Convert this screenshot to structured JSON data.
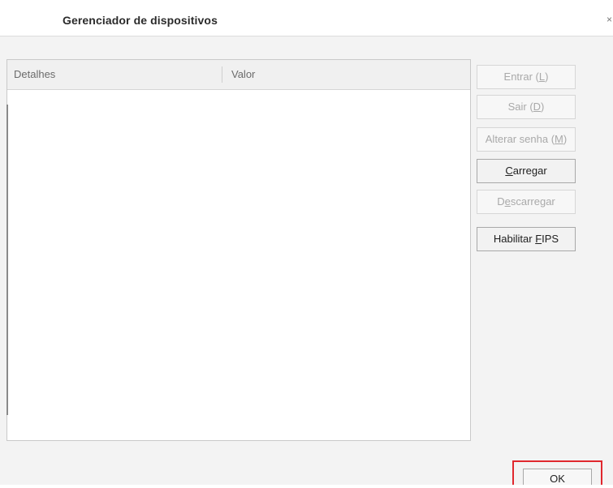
{
  "window": {
    "title": "Gerenciador de dispositivos",
    "close_glyph": "×"
  },
  "list": {
    "columns": [
      "Detalhes",
      "Valor"
    ],
    "rows": []
  },
  "buttons": [
    {
      "pre": "Entrar (",
      "key": "L",
      "post": ")",
      "enabled": false
    },
    {
      "pre": "Sair (",
      "key": "D",
      "post": ")",
      "enabled": false
    },
    {
      "pre": "Alterar senha (",
      "key": "M",
      "post": ")",
      "enabled": false
    },
    {
      "pre": "",
      "key": "C",
      "post": "arregar",
      "enabled": true
    },
    {
      "pre": "D",
      "key": "e",
      "post": "scarregar",
      "enabled": false
    },
    {
      "pre": "Habilitar ",
      "key": "F",
      "post": "IPS",
      "enabled": true
    }
  ],
  "footer": {
    "ok_label": "OK"
  },
  "colors": {
    "highlight": "#e0282e",
    "disabled_text": "#a9a9a9",
    "enabled_text": "#1e1e1e"
  },
  "icons": [
    "close-icon"
  ]
}
